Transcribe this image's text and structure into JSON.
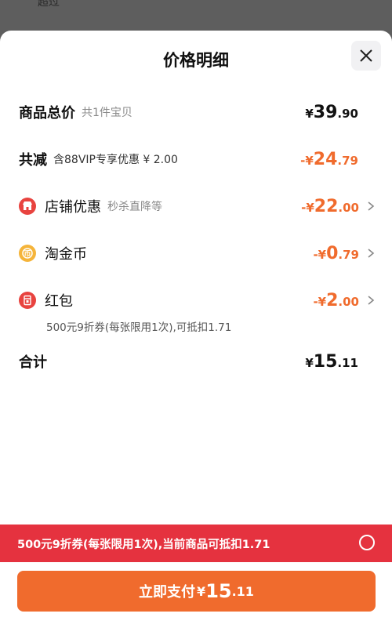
{
  "backdrop": {
    "text": "超过"
  },
  "sheet": {
    "title": "价格明细",
    "close_icon": "close-icon"
  },
  "rows": {
    "total": {
      "label": "商品总价",
      "sub": "共1件宝贝",
      "currency": "¥",
      "int": "39",
      "dec": ".90"
    },
    "reduce": {
      "label": "共减",
      "sub": "含88VIP专享优惠 ¥ 2.00",
      "currency": "-¥",
      "int": "24",
      "dec": ".79"
    },
    "shop": {
      "label": "店铺优惠",
      "sub": "秒杀直降等",
      "currency": "-¥",
      "int": "22",
      "dec": ".00",
      "icon": "shop-icon"
    },
    "coin": {
      "label": "淘金币",
      "currency": "-¥",
      "int": "0",
      "dec": ".79",
      "icon": "gold-coin-icon"
    },
    "redpack": {
      "label": "红包",
      "currency": "-¥",
      "int": "2",
      "dec": ".00",
      "icon": "red-packet-icon",
      "note": "500元9折券(每张限用1次),可抵扣1.71"
    },
    "sum": {
      "label": "合计",
      "currency": "¥",
      "int": "15",
      "dec": ".11"
    }
  },
  "banner": {
    "text": "500元9折券(每张限用1次),当前商品可抵扣1.71"
  },
  "pay_button": {
    "label": "立即支付",
    "currency": "¥",
    "int": "15",
    "dec": ".11"
  },
  "colors": {
    "accent": "#f06b2d",
    "banner": "#e5323f"
  }
}
